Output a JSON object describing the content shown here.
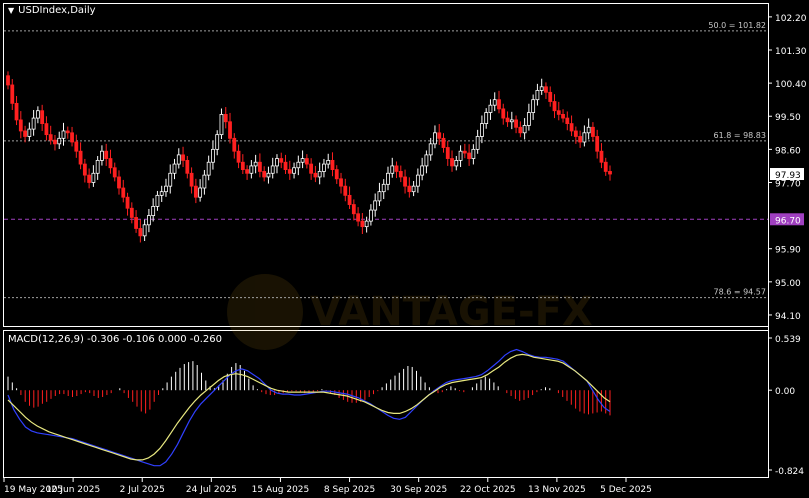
{
  "window": {
    "symbol_title": "USDIndex,Daily",
    "menu_icon": "triangle-down-icon"
  },
  "colors": {
    "background": "#000000",
    "bull_candle": "#ffffff",
    "bear_candle": "#ff2020",
    "grid_dashed": "#9a9a9a",
    "fib_level": "#a0a0a0",
    "support_line": "#a040c0",
    "support_badge": "#a040c0",
    "macd_signal": "#e8e880",
    "macd_line": "#3040ff",
    "hist_positive": "#ffffff",
    "hist_negative": "#ff2020"
  },
  "chart_data": [
    {
      "type": "candlestick",
      "title": "USDIndex,Daily",
      "y_axis": {
        "ticks": [
          "102.20",
          "101.30",
          "100.40",
          "99.50",
          "98.60",
          "97.70",
          "95.90",
          "95.00",
          "94.10"
        ],
        "ylim": [
          93.8,
          102.55
        ]
      },
      "x_axis": {
        "ticks": [
          "19 May 2025",
          "10 Jun 2025",
          "2 Jul 2025",
          "24 Jul 2025",
          "15 Aug 2025",
          "8 Sep 2025",
          "30 Sep 2025",
          "22 Oct 2025",
          "13 Nov 2025",
          "5 Dec 2025"
        ]
      },
      "levels": [
        {
          "label": "50.0 = 101.82",
          "value": 101.82
        },
        {
          "label": "61.8 = 98.83",
          "value": 98.83
        },
        {
          "label": "78.6 = 94.57",
          "value": 94.57
        }
      ],
      "support": {
        "label": "96.70",
        "value": 96.7
      },
      "current_price": {
        "label": "97.93",
        "value": 97.93
      },
      "close_series": [
        100.35,
        99.85,
        99.4,
        99.1,
        98.95,
        99.15,
        99.45,
        99.65,
        99.3,
        99.0,
        98.85,
        98.75,
        98.9,
        99.1,
        99.05,
        98.8,
        98.55,
        98.2,
        97.9,
        97.7,
        97.95,
        98.3,
        98.55,
        98.35,
        98.1,
        97.85,
        97.55,
        97.3,
        97.0,
        96.75,
        96.45,
        96.25,
        96.55,
        96.8,
        97.05,
        97.35,
        97.45,
        97.6,
        97.95,
        98.2,
        98.45,
        98.3,
        97.95,
        97.6,
        97.3,
        97.55,
        97.9,
        98.25,
        98.6,
        99.0,
        99.55,
        99.35,
        98.9,
        98.55,
        98.25,
        98.05,
        97.95,
        98.15,
        98.25,
        98.0,
        97.85,
        97.95,
        98.15,
        98.35,
        98.25,
        98.05,
        97.95,
        98.1,
        98.25,
        98.35,
        98.2,
        97.95,
        97.85,
        98.0,
        98.2,
        98.3,
        98.05,
        97.8,
        97.6,
        97.35,
        97.1,
        96.85,
        96.65,
        96.5,
        96.65,
        96.95,
        97.2,
        97.45,
        97.65,
        97.95,
        98.15,
        98.0,
        97.85,
        97.6,
        97.45,
        97.6,
        97.9,
        98.15,
        98.45,
        98.75,
        99.05,
        98.9,
        98.65,
        98.35,
        98.15,
        98.3,
        98.55,
        98.5,
        98.35,
        98.6,
        98.95,
        99.3,
        99.6,
        99.8,
        99.95,
        99.7,
        99.45,
        99.35,
        99.4,
        99.2,
        99.05,
        99.25,
        99.6,
        99.95,
        100.2,
        100.3,
        100.15,
        99.9,
        99.65,
        99.55,
        99.45,
        99.3,
        99.1,
        98.95,
        98.8,
        99.05,
        99.2,
        98.95,
        98.55,
        98.25,
        98.0,
        97.93
      ],
      "start_open": 100.6
    },
    {
      "type": "histogram_line",
      "title": "MACD(12,26,9) -0.306 -0.106 0.000 -0.260",
      "y_axis": {
        "ticks": [
          "0.539",
          "0.00",
          "-0.824"
        ],
        "ylim": [
          -0.824,
          0.539
        ]
      },
      "histogram": [
        0.14,
        0.08,
        0.02,
        -0.05,
        -0.12,
        -0.16,
        -0.18,
        -0.17,
        -0.14,
        -0.12,
        -0.09,
        -0.06,
        -0.04,
        -0.04,
        -0.06,
        -0.07,
        -0.06,
        -0.04,
        -0.02,
        -0.03,
        -0.06,
        -0.08,
        -0.07,
        -0.05,
        -0.03,
        0.0,
        0.02,
        -0.03,
        -0.08,
        -0.12,
        -0.17,
        -0.22,
        -0.24,
        -0.2,
        -0.12,
        -0.05,
        0.02,
        0.08,
        0.14,
        0.19,
        0.23,
        0.27,
        0.29,
        0.3,
        0.26,
        0.18,
        0.1,
        0.04,
        0.02,
        0.05,
        0.1,
        0.17,
        0.24,
        0.28,
        0.26,
        0.2,
        0.12,
        0.05,
        0.01,
        -0.02,
        -0.04,
        -0.05,
        -0.05,
        -0.04,
        -0.03,
        -0.02,
        -0.01,
        -0.01,
        -0.02,
        -0.03,
        -0.03,
        -0.02,
        -0.01,
        0.01,
        -0.01,
        -0.03,
        -0.05,
        -0.08,
        -0.1,
        -0.12,
        -0.13,
        -0.13,
        -0.12,
        -0.1,
        -0.07,
        -0.04,
        -0.01,
        0.03,
        0.07,
        0.11,
        0.15,
        0.18,
        0.22,
        0.25,
        0.24,
        0.2,
        0.14,
        0.08,
        0.03,
        -0.01,
        -0.03,
        -0.02,
        0.01,
        0.04,
        0.02,
        -0.01,
        -0.02,
        0.0,
        0.03,
        0.07,
        0.11,
        0.14,
        0.12,
        0.08,
        0.04,
        0.0,
        -0.03,
        -0.06,
        -0.09,
        -0.11,
        -0.1,
        -0.08,
        -0.05,
        -0.02,
        0.01,
        0.03,
        0.02,
        0.0,
        -0.03,
        -0.07,
        -0.11,
        -0.15,
        -0.19,
        -0.22,
        -0.24,
        -0.25,
        -0.24,
        -0.23,
        -0.22,
        -0.24,
        -0.26
      ],
      "macd_line": [
        -0.05,
        -0.2,
        -0.3,
        -0.38,
        -0.42,
        -0.44,
        -0.45,
        -0.46,
        -0.47,
        -0.48,
        -0.49,
        -0.5,
        -0.52,
        -0.54,
        -0.56,
        -0.58,
        -0.6,
        -0.62,
        -0.64,
        -0.66,
        -0.68,
        -0.7,
        -0.72,
        -0.74,
        -0.76,
        -0.78,
        -0.78,
        -0.74,
        -0.66,
        -0.56,
        -0.44,
        -0.32,
        -0.22,
        -0.14,
        -0.08,
        -0.02,
        0.04,
        0.1,
        0.16,
        0.2,
        0.22,
        0.2,
        0.16,
        0.12,
        0.06,
        0.0,
        -0.03,
        -0.04,
        -0.04,
        -0.05,
        -0.05,
        -0.04,
        -0.03,
        -0.02,
        -0.01,
        -0.01,
        -0.02,
        -0.03,
        -0.04,
        -0.06,
        -0.08,
        -0.11,
        -0.14,
        -0.18,
        -0.22,
        -0.26,
        -0.29,
        -0.3,
        -0.28,
        -0.22,
        -0.16,
        -0.1,
        -0.05,
        0.0,
        0.04,
        0.08,
        0.1,
        0.11,
        0.12,
        0.13,
        0.14,
        0.16,
        0.2,
        0.25,
        0.3,
        0.36,
        0.4,
        0.42,
        0.4,
        0.37,
        0.35,
        0.34,
        0.34,
        0.33,
        0.32,
        0.3,
        0.25,
        0.2,
        0.15,
        0.1,
        0.0,
        -0.1,
        -0.18,
        -0.22
      ],
      "signal_line": [
        -0.1,
        -0.16,
        -0.22,
        -0.28,
        -0.33,
        -0.37,
        -0.4,
        -0.43,
        -0.45,
        -0.47,
        -0.49,
        -0.51,
        -0.53,
        -0.55,
        -0.57,
        -0.59,
        -0.61,
        -0.63,
        -0.65,
        -0.67,
        -0.69,
        -0.71,
        -0.72,
        -0.72,
        -0.7,
        -0.66,
        -0.6,
        -0.52,
        -0.43,
        -0.34,
        -0.26,
        -0.18,
        -0.11,
        -0.05,
        0.0,
        0.05,
        0.1,
        0.14,
        0.16,
        0.17,
        0.16,
        0.14,
        0.11,
        0.08,
        0.05,
        0.02,
        0.0,
        -0.01,
        -0.02,
        -0.02,
        -0.02,
        -0.02,
        -0.02,
        -0.02,
        -0.02,
        -0.03,
        -0.04,
        -0.05,
        -0.06,
        -0.08,
        -0.1,
        -0.12,
        -0.15,
        -0.18,
        -0.21,
        -0.23,
        -0.24,
        -0.24,
        -0.22,
        -0.19,
        -0.15,
        -0.1,
        -0.05,
        -0.01,
        0.03,
        0.06,
        0.08,
        0.09,
        0.1,
        0.11,
        0.12,
        0.13,
        0.16,
        0.2,
        0.24,
        0.29,
        0.33,
        0.36,
        0.37,
        0.36,
        0.34,
        0.33,
        0.32,
        0.31,
        0.3,
        0.28,
        0.24,
        0.2,
        0.15,
        0.1,
        0.04,
        -0.02,
        -0.08,
        -0.12
      ]
    }
  ]
}
